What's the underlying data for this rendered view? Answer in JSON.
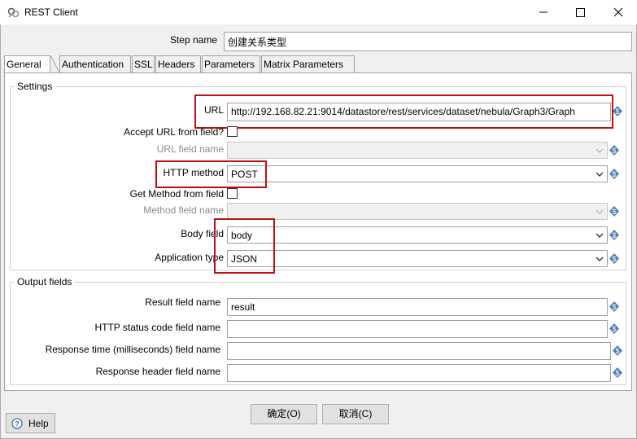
{
  "window": {
    "title": "REST Client"
  },
  "step_name": {
    "label": "Step name",
    "value": "创建关系类型"
  },
  "tabs": [
    {
      "label": "General",
      "active": true
    },
    {
      "label": "Authentication",
      "active": false
    },
    {
      "label": "SSL",
      "active": false
    },
    {
      "label": "Headers",
      "active": false
    },
    {
      "label": "Parameters",
      "active": false
    },
    {
      "label": "Matrix Parameters",
      "active": false
    }
  ],
  "settings": {
    "group_title": "Settings",
    "url_label": "URL",
    "url_value": "http://192.168.82.21:9014/datastore/rest/services/dataset/nebula/Graph3/Graph",
    "accept_url_label": "Accept URL from field?",
    "url_field_label": "URL field name",
    "url_field_value": "",
    "http_method_label": "HTTP method",
    "http_method_value": "POST",
    "get_method_label": "Get Method from field",
    "method_field_label": "Method field name",
    "method_field_value": "",
    "body_field_label": "Body field",
    "body_field_value": "body",
    "app_type_label": "Application type",
    "app_type_value": "JSON"
  },
  "output": {
    "group_title": "Output fields",
    "result_label": "Result field name",
    "result_value": "result",
    "status_label": "HTTP status code field name",
    "status_value": "",
    "response_time_label": "Response time (milliseconds) field name",
    "response_time_value": "",
    "response_header_label": "Response header field name",
    "response_header_value": ""
  },
  "buttons": {
    "ok": "确定(O)",
    "cancel": "取消(C)",
    "help": "Help"
  },
  "colors": {
    "highlight_red": "#b11111",
    "variable_icon_blue": "#4a7fb5"
  }
}
